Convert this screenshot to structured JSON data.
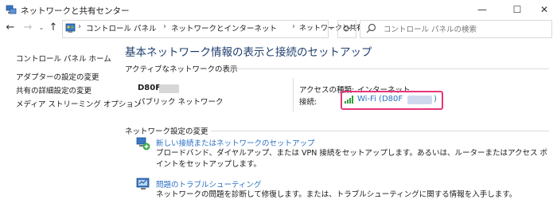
{
  "window": {
    "title": "ネットワークと共有センター"
  },
  "address_bar": {
    "breadcrumbs": [
      "コントロール パネル",
      "ネットワークとインターネット",
      "ネットワークと共有センター"
    ],
    "search_placeholder": "コントロール パネルの検索"
  },
  "sidebar": {
    "items": [
      {
        "label": "コントロール パネル ホーム"
      },
      {
        "label": "アダプターの設定の変更"
      },
      {
        "label": "共有の詳細設定の変更"
      },
      {
        "label": "メディア ストリーミング オプション"
      }
    ]
  },
  "main": {
    "heading": "基本ネットワーク情報の表示と接続のセットアップ",
    "active_networks_label": "アクティブなネットワークの表示",
    "network": {
      "name": "D80F",
      "type": "パブリック ネットワーク",
      "access_type_label": "アクセスの種類:",
      "access_type_value": "インターネット",
      "connection_label": "接続:",
      "connection_value": "Wi-Fi (D80F",
      "connection_close": ")"
    },
    "change_settings_label": "ネットワーク設定の変更",
    "tasks": [
      {
        "title": "新しい接続またはネットワークのセットアップ",
        "description": "ブロードバンド、ダイヤルアップ、または VPN 接続をセットアップします。あるいは、ルーターまたはアクセス ポイントをセットアップします。"
      },
      {
        "title": "問題のトラブルシューティング",
        "description": "ネットワークの問題を診断して修復します。または、トラブルシューティングに関する情報を入手します。"
      }
    ]
  },
  "colors": {
    "heading": "#1f3f6e",
    "link": "#2a6fc4",
    "highlight_border": "#e8347a",
    "signal": "#2f9e3a"
  }
}
